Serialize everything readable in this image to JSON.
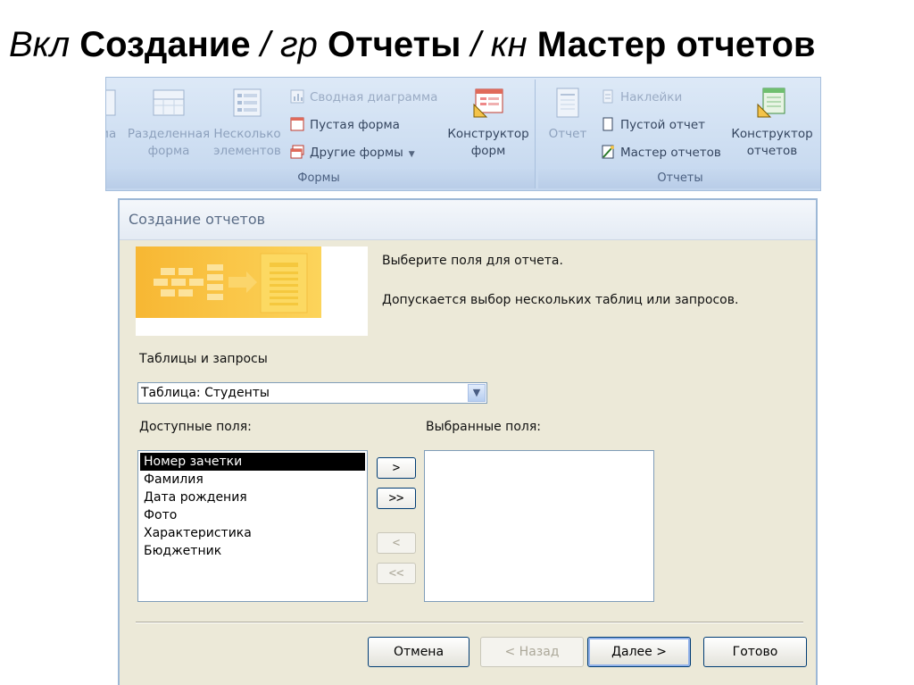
{
  "slide_title": {
    "p1": "Вкл ",
    "p2": "Создание",
    "p3": " / гр ",
    "p4": "Отчеты",
    "p5": " / кн ",
    "p6": "Мастер отчетов"
  },
  "ribbon": {
    "forms_group": {
      "caption": "Формы",
      "cut_label": "ма",
      "split_form": [
        "Разделенная",
        "форма"
      ],
      "multiple_items": [
        "Несколько",
        "элементов"
      ],
      "pivot_chart": "Сводная диаграмма",
      "blank_form": "Пустая форма",
      "more_forms": "Другие формы",
      "form_design": [
        "Конструктор",
        "форм"
      ]
    },
    "reports_group": {
      "caption": "Отчеты",
      "report": "Отчет",
      "labels": "Наклейки",
      "blank_report": "Пустой отчет",
      "report_wizard": "Мастер отчетов",
      "report_design": [
        "Конструктор",
        "отчетов"
      ]
    }
  },
  "dialog": {
    "title": "Создание отчетов",
    "instruction1": "Выберите поля для отчета.",
    "instruction2": "Допускается выбор нескольких таблиц или запросов.",
    "tables_label": "Таблицы и запросы",
    "table_select_value": "Таблица: Студенты",
    "available_label": "Доступные поля:",
    "selected_label": "Выбранные поля:",
    "available_fields": [
      "Номер зачетки",
      "Фамилия",
      "Дата рождения",
      "Фото",
      "Характеристика",
      "Бюджетник"
    ],
    "selected_fields": [],
    "move_buttons": {
      "add_one": ">",
      "add_all": ">>",
      "remove_one": "<",
      "remove_all": "<<"
    },
    "buttons": {
      "cancel": "Отмена",
      "back": "< Назад",
      "next": "Далее >",
      "finish": "Готово"
    }
  },
  "colors": {
    "ribbon": "#cfdff2",
    "dialog_face": "#ece9d8",
    "selection": "#000000",
    "banner": "#f7b733"
  }
}
